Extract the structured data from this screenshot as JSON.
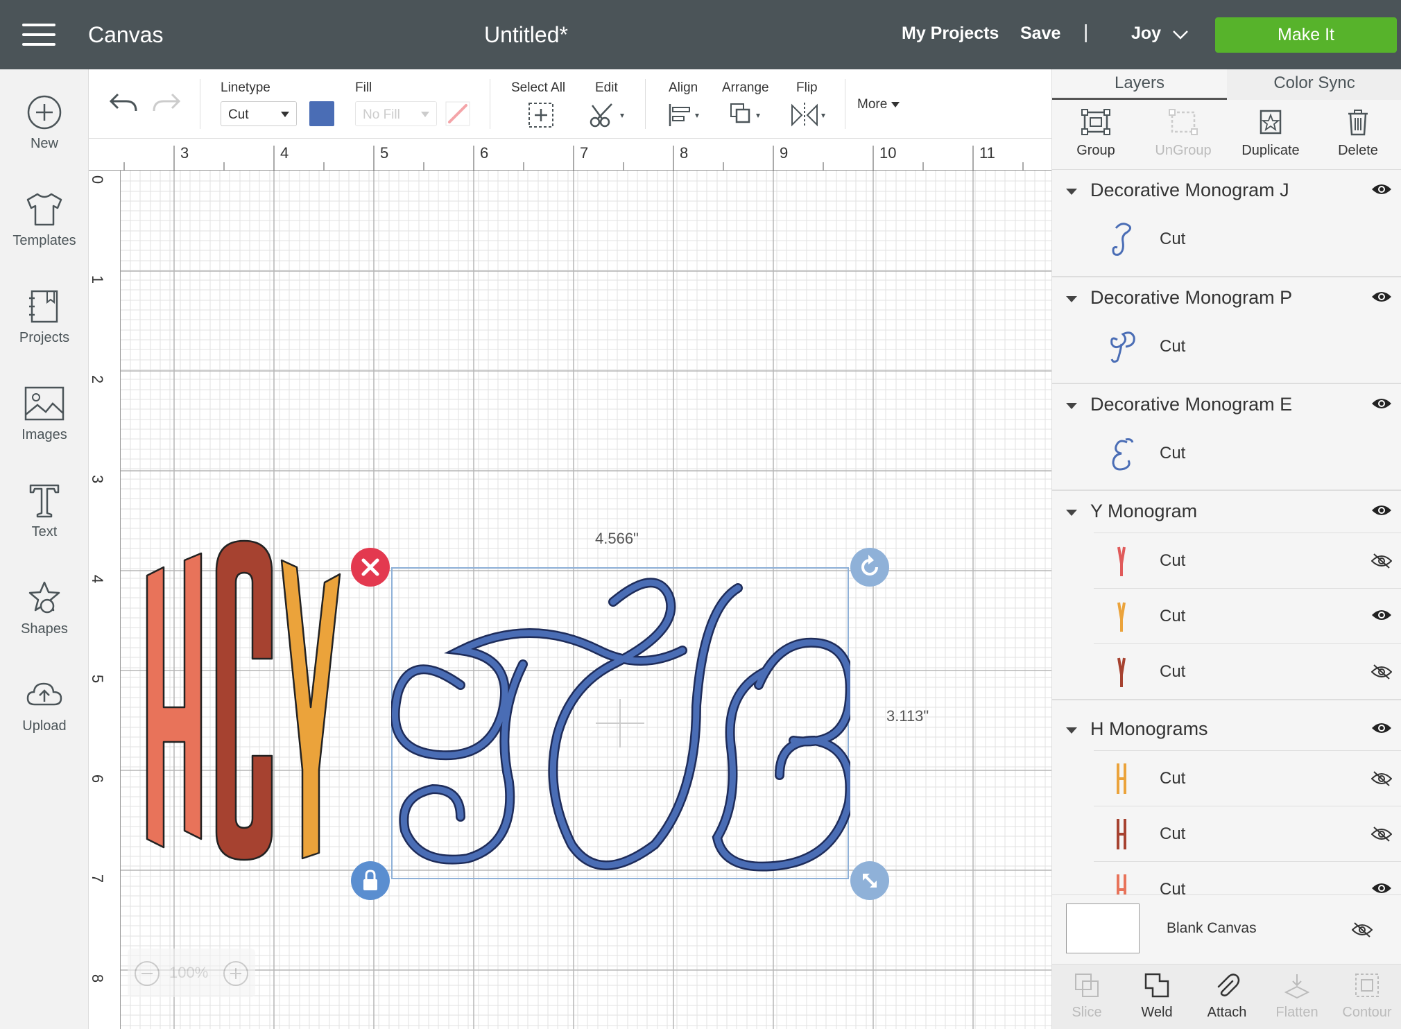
{
  "header": {
    "app_title": "Canvas",
    "doc_title": "Untitled*",
    "my_projects": "My Projects",
    "save": "Save",
    "separator": "|",
    "user": "Joy",
    "make_it": "Make It",
    "accent": "#57b32b"
  },
  "sidebar": {
    "items": [
      {
        "label": "New",
        "icon": "plus-circle-icon"
      },
      {
        "label": "Templates",
        "icon": "tshirt-icon"
      },
      {
        "label": "Projects",
        "icon": "notebook-icon"
      },
      {
        "label": "Images",
        "icon": "image-icon"
      },
      {
        "label": "Text",
        "icon": "text-t-icon"
      },
      {
        "label": "Shapes",
        "icon": "shapes-icon"
      },
      {
        "label": "Upload",
        "icon": "cloud-upload-icon"
      }
    ]
  },
  "toolbar": {
    "linetype_label": "Linetype",
    "linetype_value": "Cut",
    "linetype_color": "#4a6db5",
    "fill_label": "Fill",
    "fill_value": "No Fill",
    "select_all": "Select All",
    "edit": "Edit",
    "align": "Align",
    "arrange": "Arrange",
    "flip": "Flip",
    "more": "More"
  },
  "canvas": {
    "ruler_x": [
      "3",
      "4",
      "5",
      "6",
      "7",
      "8",
      "9",
      "10",
      "11"
    ],
    "ruler_y": [
      "0",
      "1",
      "2",
      "3",
      "4",
      "5",
      "6",
      "7",
      "8"
    ],
    "width_readout": "4.566\"",
    "height_readout": "3.113\"",
    "zoom": "100%",
    "hcy_text": "HCY",
    "monogram_letters": [
      "P",
      "J",
      "E"
    ],
    "colors": {
      "h": "#e8735a",
      "c": "#a64230",
      "y": "#eba33b",
      "monogram": "#4a6db5"
    }
  },
  "panel": {
    "tabs": [
      "Layers",
      "Color Sync"
    ],
    "tools": [
      {
        "label": "Group",
        "enabled": true,
        "icon": "group-icon"
      },
      {
        "label": "UnGroup",
        "enabled": false,
        "icon": "ungroup-icon"
      },
      {
        "label": "Duplicate",
        "enabled": true,
        "icon": "duplicate-icon"
      },
      {
        "label": "Delete",
        "enabled": true,
        "icon": "trash-icon"
      }
    ],
    "groups": [
      {
        "name": "Decorative Monogram J",
        "rows": [
          {
            "op": "Cut",
            "glyph": "J",
            "color": "#4a6db5",
            "visible": true
          }
        ]
      },
      {
        "name": "Decorative Monogram P",
        "rows": [
          {
            "op": "Cut",
            "glyph": "P",
            "color": "#4a6db5",
            "visible": true
          }
        ]
      },
      {
        "name": "Decorative Monogram E",
        "rows": [
          {
            "op": "Cut",
            "glyph": "E",
            "color": "#4a6db5",
            "visible": true
          }
        ]
      },
      {
        "name": "Y Monogram",
        "rows": [
          {
            "op": "Cut",
            "glyph": "Y",
            "color": "#e05a5a",
            "visible": false
          },
          {
            "op": "Cut",
            "glyph": "Y",
            "color": "#eba33b",
            "visible": true
          },
          {
            "op": "Cut",
            "glyph": "Y",
            "color": "#a64230",
            "visible": false
          }
        ]
      },
      {
        "name": "H Monograms",
        "rows": [
          {
            "op": "Cut",
            "glyph": "H",
            "color": "#eba33b",
            "visible": false
          },
          {
            "op": "Cut",
            "glyph": "H",
            "color": "#a64230",
            "visible": false
          },
          {
            "op": "Cut",
            "glyph": "H",
            "color": "#e8735a",
            "visible": true
          }
        ]
      }
    ],
    "blank_canvas": "Blank Canvas",
    "bottom_tools": [
      {
        "label": "Slice",
        "enabled": false,
        "icon": "slice-icon"
      },
      {
        "label": "Weld",
        "enabled": true,
        "icon": "weld-icon"
      },
      {
        "label": "Attach",
        "enabled": true,
        "icon": "paperclip-icon"
      },
      {
        "label": "Flatten",
        "enabled": false,
        "icon": "flatten-icon"
      },
      {
        "label": "Contour",
        "enabled": false,
        "icon": "contour-icon"
      }
    ]
  }
}
